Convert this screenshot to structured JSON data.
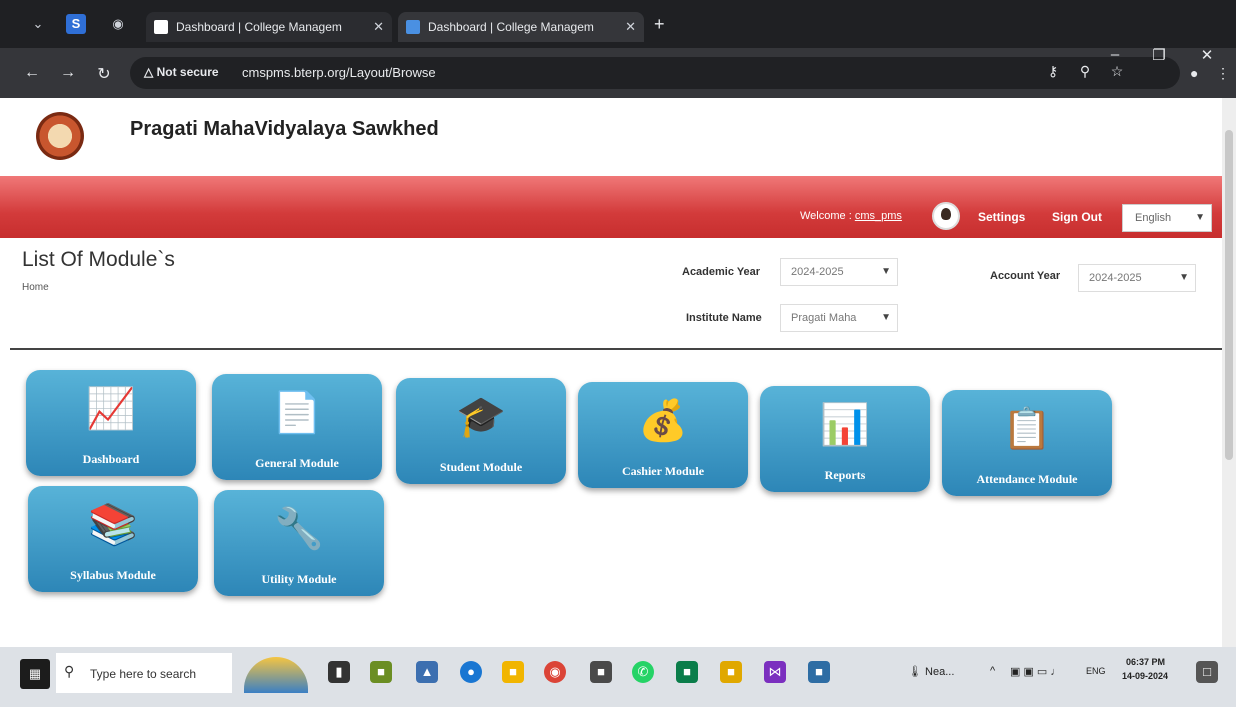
{
  "browser": {
    "tabs": [
      {
        "title": "Dashboard | College Managem"
      },
      {
        "title": "Dashboard | College Managem"
      }
    ],
    "not_secure": "Not secure",
    "url": "cmspms.bterp.org/Layout/Browse"
  },
  "site": {
    "title": "Pragati MahaVidyalaya Sawkhed"
  },
  "topbar": {
    "welcome": "Welcome :",
    "username": "cms_pms",
    "settings": "Settings",
    "sign_out": "Sign Out",
    "language": "English"
  },
  "page": {
    "title": "List Of Module`s",
    "breadcrumb": "Home"
  },
  "filters": {
    "academic_year_label": "Academic Year",
    "academic_year_value": "2024-2025",
    "account_year_label": "Account Year",
    "account_year_value": "2024-2025",
    "institute_label": "Institute Name",
    "institute_value": "Pragati Maha"
  },
  "modules": [
    {
      "label": "Dashboard",
      "icon": "money-chart-icon"
    },
    {
      "label": "General Module",
      "icon": "document-icon"
    },
    {
      "label": "Student Module",
      "icon": "graduates-icon"
    },
    {
      "label": "Cashier Module",
      "icon": "money-chart-icon"
    },
    {
      "label": "Reports",
      "icon": "report-icon"
    },
    {
      "label": "Attendance Module",
      "icon": "clipboard-icon"
    },
    {
      "label": "Syllabus Module",
      "icon": "books-icon"
    },
    {
      "label": "Utility Module",
      "icon": "tools-icon"
    }
  ],
  "taskbar": {
    "search_placeholder": "Type here to search",
    "weather": "Nea...",
    "lang": "ENG",
    "time": "06:37 PM",
    "date": "14-09-2024"
  },
  "colors": {
    "brand_red": "#d33b3b",
    "module_blue": "#2d86b7",
    "chrome_dark": "#35363a"
  }
}
